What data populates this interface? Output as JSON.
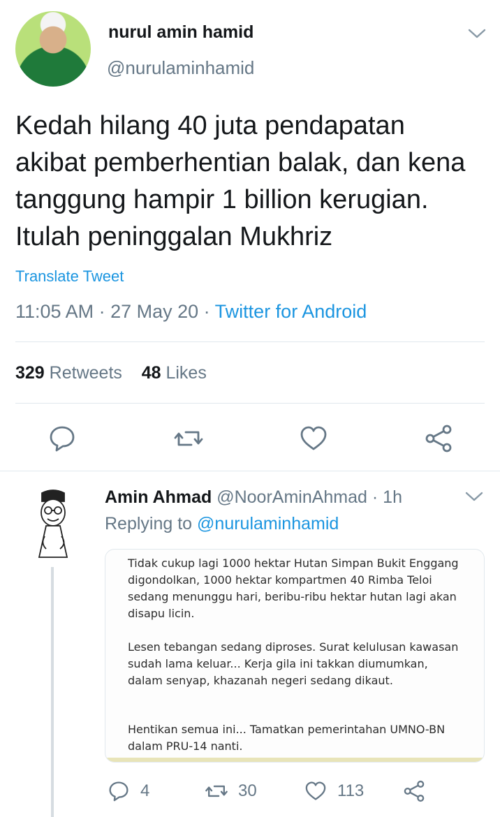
{
  "tweet": {
    "author_name": "nurul amin hamid",
    "author_handle": "@nurulaminhamid",
    "text_lines": [
      "Kedah hilang 40 juta pendapatan",
      "akibat pemberhentian balak, dan kena",
      "tanggung hampir 1 billion kerugian.",
      "Itulah peninggalan Mukhriz"
    ],
    "translate_label": "Translate Tweet",
    "time": "11:05 AM",
    "date": "27 May 20",
    "source": "Twitter for Android",
    "retweet_count": "329",
    "retweet_label": "Retweets",
    "like_count": "48",
    "like_label": "Likes"
  },
  "reply": {
    "author_name": "Amin Ahmad",
    "author_handle": "@NoorAminAhmad",
    "age": "1h",
    "replying_prefix": "Replying to",
    "replying_handle": "@nurulaminhamid",
    "image_text": {
      "para1": "Tidak cukup lagi 1000 hektar Hutan Simpan Bukit Enggang digondolkan, 1000 hektar kompartmen 40 Rimba Teloi sedang menunggu hari, beribu-ribu hektar hutan lagi akan disapu licin.",
      "para2": "Lesen tebangan sedang diproses. Surat kelulusan kawasan sudah lama keluar... Kerja gila ini takkan diumumkan, dalam senyap, khazanah negeri sedang dikaut.",
      "para3": "Hentikan semua ini... Tamatkan pemerintahan UMNO-BN dalam PRU-14 nanti."
    },
    "reply_count": "4",
    "retweet_count": "30",
    "like_count": "113"
  },
  "colors": {
    "accent": "#1b95e0",
    "secondary_text": "#657786",
    "primary_text": "#14171a",
    "divider": "#e1e8ed"
  },
  "icons": [
    "chevron-down-icon",
    "reply-icon",
    "retweet-icon",
    "like-icon",
    "share-icon"
  ]
}
